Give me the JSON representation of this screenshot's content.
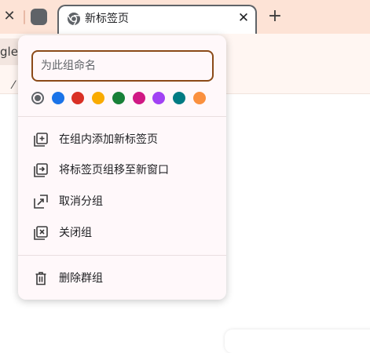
{
  "tabstrip": {
    "active_tab_title": "新标签页",
    "close_glyph": "✕",
    "new_tab_glyph": "+",
    "group_chip_color": "#5f6368"
  },
  "toolbar": {
    "omnibox_fragment": "gle"
  },
  "bookmarks": {
    "fragment": "⁄"
  },
  "group_menu": {
    "name_input": {
      "placeholder": "为此组命名",
      "value": ""
    },
    "colors": [
      {
        "name": "grey",
        "hex": "#5f6368",
        "selected": true
      },
      {
        "name": "blue",
        "hex": "#1a73e8",
        "selected": false
      },
      {
        "name": "red",
        "hex": "#d93025",
        "selected": false
      },
      {
        "name": "yellow",
        "hex": "#f9ab00",
        "selected": false
      },
      {
        "name": "green",
        "hex": "#188038",
        "selected": false
      },
      {
        "name": "pink",
        "hex": "#d01884",
        "selected": false
      },
      {
        "name": "purple",
        "hex": "#a142f4",
        "selected": false
      },
      {
        "name": "cyan",
        "hex": "#007b83",
        "selected": false
      },
      {
        "name": "orange",
        "hex": "#fa903e",
        "selected": false
      }
    ],
    "items": [
      {
        "label": "在组内添加新标签页",
        "icon": "add-tab-icon"
      },
      {
        "label": "将标签页组移至新窗口",
        "icon": "move-to-window-icon"
      },
      {
        "label": "取消分组",
        "icon": "ungroup-icon"
      },
      {
        "label": "关闭组",
        "icon": "close-group-icon"
      },
      {
        "label": "删除群组",
        "icon": "trash-icon"
      }
    ]
  }
}
